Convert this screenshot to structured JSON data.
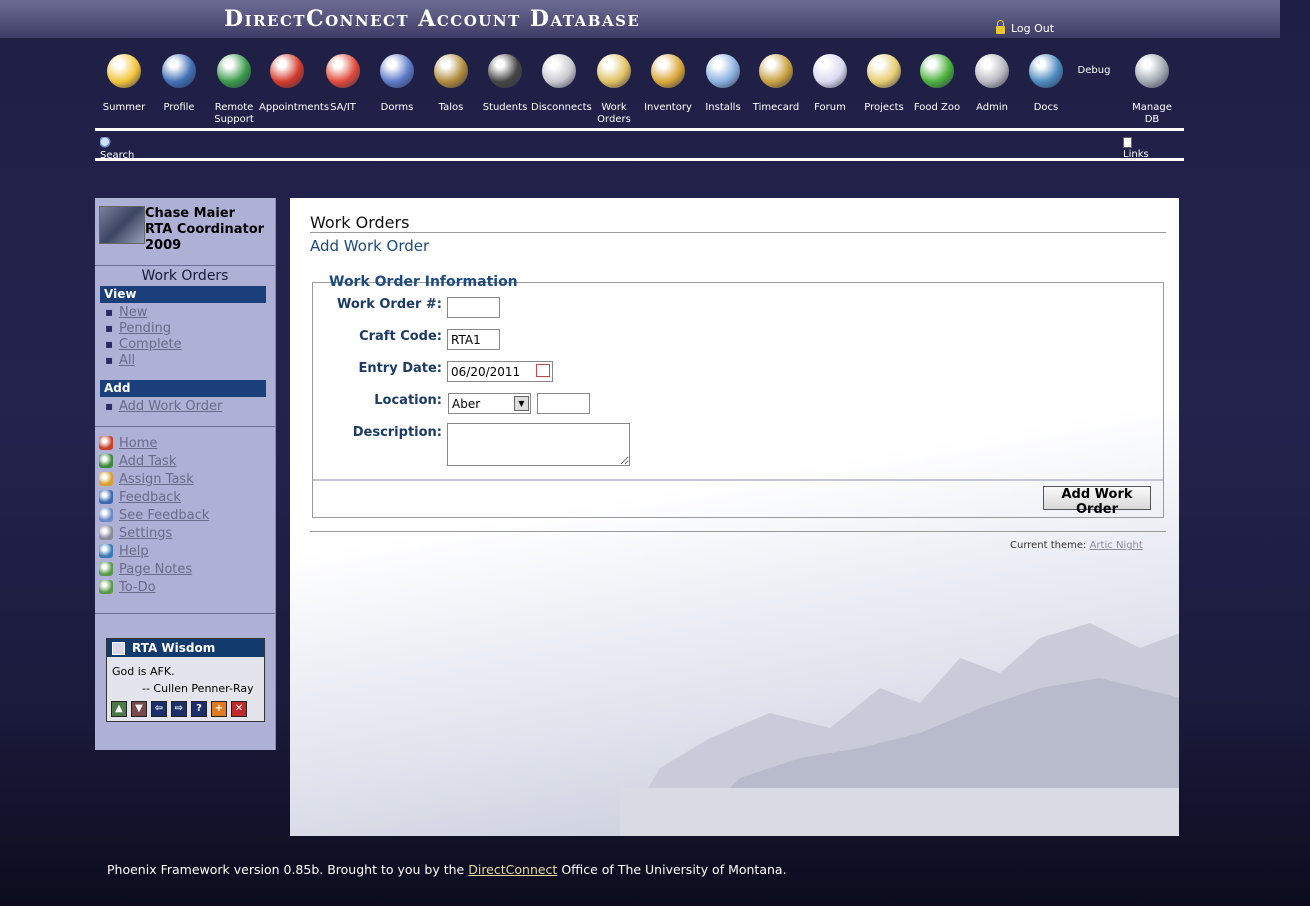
{
  "header": {
    "title": "DirectConnect Account Database",
    "logout_label": "Log Out"
  },
  "nav": {
    "items": [
      {
        "label": "Summer",
        "icon": "sun-face-icon",
        "color": "#f2c43a"
      },
      {
        "label": "Profile",
        "icon": "profile-icon",
        "color": "#3f6fb6"
      },
      {
        "label": "Remote Support",
        "icon": "globe-help-icon",
        "color": "#3a9a4a"
      },
      {
        "label": "Appointments",
        "icon": "alarm-clock-icon",
        "color": "#d23a2a"
      },
      {
        "label": "SA/IT",
        "icon": "first-aid-icon",
        "color": "#e04a3a"
      },
      {
        "label": "Dorms",
        "icon": "building-icon",
        "color": "#5a7ac8"
      },
      {
        "label": "Talos",
        "icon": "helmet-icon",
        "color": "#b08a3a"
      },
      {
        "label": "Students",
        "icon": "student-icon",
        "color": "#444444"
      },
      {
        "label": "Disconnects",
        "icon": "disconnect-icon",
        "color": "#c8c8d0"
      },
      {
        "label": "Work Orders",
        "icon": "clipboard-icon",
        "color": "#e0c060"
      },
      {
        "label": "Inventory",
        "icon": "box-icon",
        "color": "#d9a638"
      },
      {
        "label": "Installs",
        "icon": "install-icon",
        "color": "#8ab0e0"
      },
      {
        "label": "Timecard",
        "icon": "money-bag-icon",
        "color": "#c8a040"
      },
      {
        "label": "Forum",
        "icon": "speech-bubble-icon",
        "color": "#d8d8f0"
      },
      {
        "label": "Projects",
        "icon": "folders-icon",
        "color": "#e6cc70"
      },
      {
        "label": "Food Zoo",
        "icon": "apple-icon",
        "color": "#4ab03a"
      },
      {
        "label": "Admin",
        "icon": "gears-icon",
        "color": "#b8b8c0"
      },
      {
        "label": "Docs",
        "icon": "books-icon",
        "color": "#4a8ac0"
      },
      {
        "label": "Debug",
        "icon": "",
        "color": ""
      },
      {
        "label": "Manage DB",
        "icon": "database-icon",
        "color": "#a0a8b0"
      }
    ]
  },
  "subnav": {
    "search_label": "Search",
    "links_label": "Links"
  },
  "user": {
    "name": "Chase Maier",
    "role": "RTA Coordinator",
    "year": "2009"
  },
  "sidebar": {
    "section_title": "Work Orders",
    "view_header": "View",
    "view_links": [
      "New",
      "Pending",
      "Complete",
      "All"
    ],
    "add_header": "Add",
    "add_links": [
      "Add Work Order"
    ],
    "tools": [
      {
        "label": "Home",
        "icon": "house-icon"
      },
      {
        "label": "Add Task",
        "icon": "checkbox-icon"
      },
      {
        "label": "Assign Task",
        "icon": "assign-icon"
      },
      {
        "label": "Feedback",
        "icon": "info-icon"
      },
      {
        "label": "See Feedback",
        "icon": "magnifier-icon"
      },
      {
        "label": "Settings",
        "icon": "tools-icon"
      },
      {
        "label": "Help",
        "icon": "help-icon"
      },
      {
        "label": "Page Notes",
        "icon": "notepad-icon"
      },
      {
        "label": "To-Do",
        "icon": "todo-icon"
      }
    ]
  },
  "wisdom": {
    "title": "RTA Wisdom",
    "quote": "God is AFK.",
    "author": "-- Cullen Penner-Ray"
  },
  "main": {
    "title": "Work Orders",
    "subtitle": "Add Work Order",
    "legend": "Work Order Information",
    "fields": {
      "work_order_label": "Work Order #:",
      "work_order_value": "",
      "craft_code_label": "Craft Code:",
      "craft_code_value": "RTA1",
      "entry_date_label": "Entry Date:",
      "entry_date_value": "06/20/2011",
      "location_label": "Location:",
      "location_value": "Aber",
      "location_extra_value": "",
      "description_label": "Description:",
      "description_value": ""
    },
    "submit_label": "Add Work Order",
    "theme_label": "Current theme:",
    "theme_name": "Artic Night"
  },
  "footer": {
    "text_before": "Phoenix Framework version 0.85b. Brought to you by the",
    "link": "DirectConnect",
    "text_after": "Office of The University of Montana."
  }
}
